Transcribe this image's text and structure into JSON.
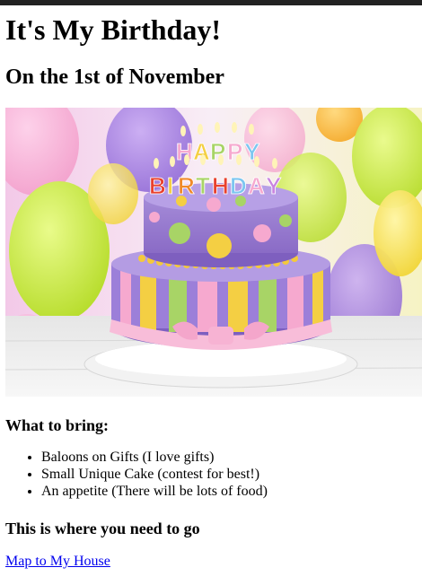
{
  "page": {
    "title": "It's My Birthday!",
    "subtitle": "On the 1st of November"
  },
  "image": {
    "description": "birthday-cake-photo",
    "candle_text": "HAPPY BIRTHDAY"
  },
  "bring": {
    "heading": "What to bring:",
    "items": [
      "Baloons on Gifts (I love gifts)",
      "Small Unique Cake (contest for best!)",
      "An appetite (There will be lots of food)"
    ]
  },
  "directions": {
    "heading": "This is where you need to go",
    "link_label": "Map to My House"
  },
  "colors": {
    "link": "#0000ee",
    "top_bar": "#222222"
  }
}
